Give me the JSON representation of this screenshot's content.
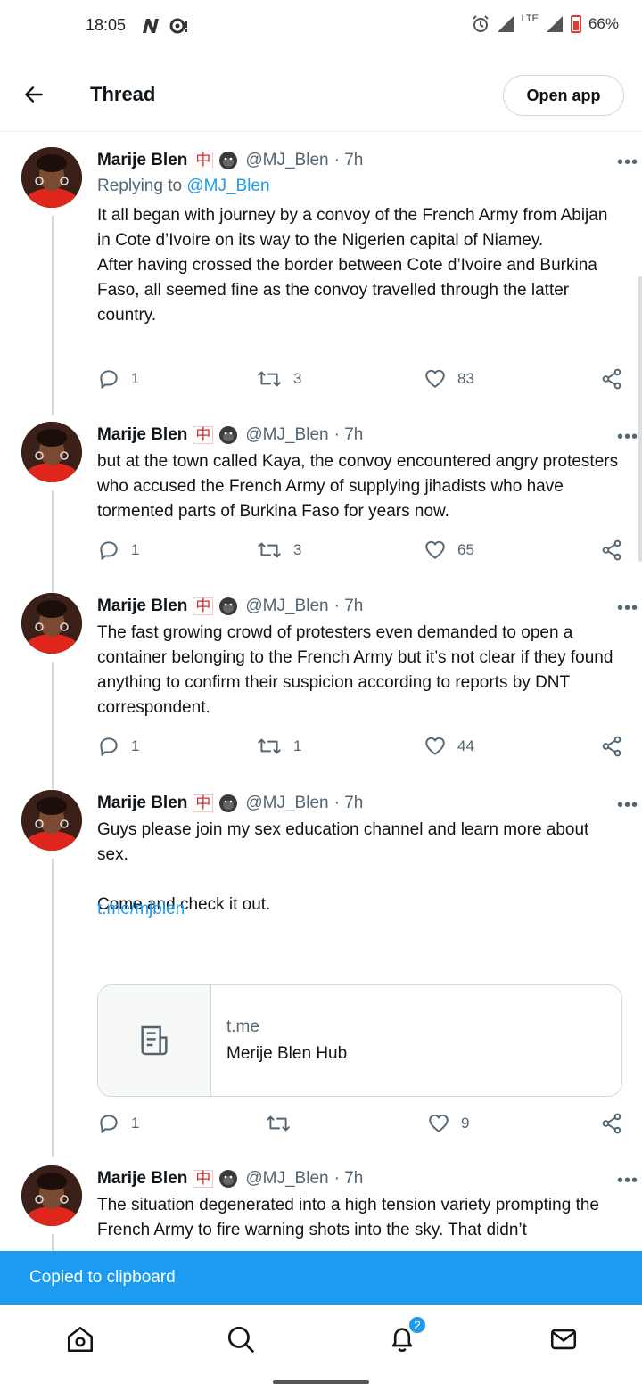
{
  "status_bar": {
    "time": "18:05",
    "battery": "66%",
    "network": "LTE"
  },
  "header": {
    "title": "Thread",
    "open_app": "Open app"
  },
  "colors": {
    "accent": "#1d9bf0",
    "text": "#0f1419",
    "muted": "#536471",
    "battery": "#e53935"
  },
  "tweets": [
    {
      "name": "Marije Blen",
      "badge": "中",
      "handle": "@MJ_Blen",
      "time": "· 7h",
      "replying_label": "Replying to",
      "replying_to": "@MJ_Blen",
      "text": "It all began with journey by a convoy of the French Army from Abijan in Cote d’Ivoire on its way to the Nigerien capital of Niamey.\nAfter having crossed the border between Cote d’Ivoire and Burkina Faso, all seemed fine as the convoy travelled through the latter country.",
      "replies": "1",
      "retweets": "3",
      "likes": "83"
    },
    {
      "name": "Marije Blen",
      "badge": "中",
      "handle": "@MJ_Blen",
      "time": "· 7h",
      "text": "but at the town called Kaya, the convoy encountered angry protesters who accused the French Army of supplying jihadists who have tormented parts of Burkina Faso for years now.",
      "replies": "1",
      "retweets": "3",
      "likes": "65"
    },
    {
      "name": "Marije Blen",
      "badge": "中",
      "handle": "@MJ_Blen",
      "time": "· 7h",
      "text": "The fast growing crowd of protesters even demanded to open a container belonging to the French Army but it’s not clear if they found anything to confirm their suspicion according to reports by DNT correspondent.",
      "replies": "1",
      "retweets": "1",
      "likes": "44"
    },
    {
      "name": "Marije Blen",
      "badge": "中",
      "handle": "@MJ_Blen",
      "time": "· 7h",
      "text": "Guys please join my sex education channel and learn more about sex.\n\nCome and check it out.",
      "link": "t.me/mjblen",
      "card": {
        "domain": "t.me",
        "title": "Merije Blen Hub"
      },
      "replies": "1",
      "retweets": "",
      "likes": "9"
    },
    {
      "name": "Marije Blen",
      "badge": "中",
      "handle": "@MJ_Blen",
      "time": "· 7h",
      "text": "The situation degenerated into a high tension variety prompting the French Army to fire warning shots into the sky. That didn’t"
    }
  ],
  "toast": "Copied to clipboard",
  "nav": {
    "notifications_count": "2"
  }
}
